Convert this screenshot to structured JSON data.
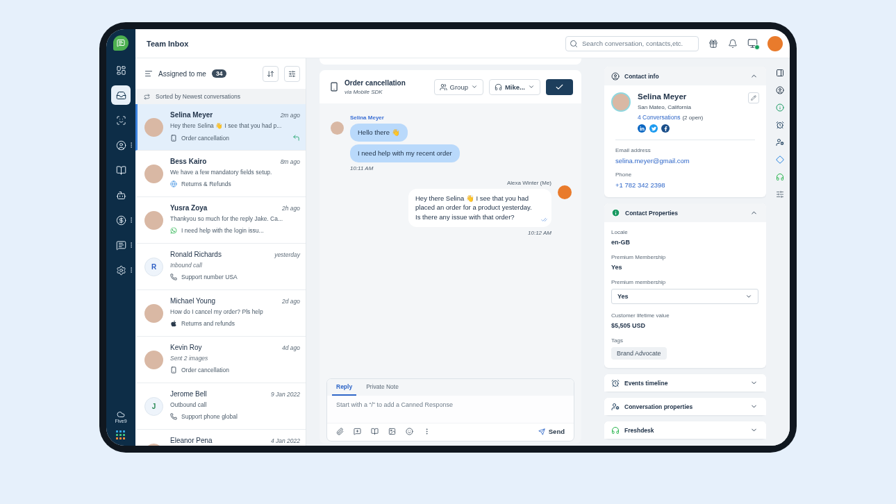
{
  "nav": {
    "items": [
      {
        "kind": "dashboard",
        "selected": false,
        "more": false
      },
      {
        "kind": "inbox",
        "selected": true,
        "more": false
      },
      {
        "kind": "contact-scan",
        "selected": false,
        "more": false
      },
      {
        "kind": "contact",
        "selected": false,
        "more": true
      },
      {
        "kind": "book",
        "selected": false,
        "more": false
      },
      {
        "kind": "bot",
        "selected": false,
        "more": false
      },
      {
        "kind": "dollar",
        "selected": false,
        "more": true
      },
      {
        "kind": "chat",
        "selected": false,
        "more": true
      },
      {
        "kind": "settings",
        "selected": false,
        "more": true
      }
    ],
    "logo_text": "Five9"
  },
  "header": {
    "title": "Team Inbox",
    "search": {
      "placeholder": "Search conversation, contacts,etc."
    }
  },
  "list": {
    "filter": "Assigned to me",
    "count": "34",
    "sort_info": "Sorted by Newest conversations",
    "conversations": [
      {
        "name": "Selina Meyer",
        "preview": "Hey there Selina 👋 I see that you had p...",
        "preview_italic": false,
        "time": "2m ago",
        "channel": {
          "kind": "mobile",
          "label": "Order cancellation"
        },
        "avatar": {
          "kind": "photo"
        },
        "selected": true,
        "unread": true,
        "replied": true
      },
      {
        "name": "Bess Kairo",
        "preview": "We have a few mandatory fields setup.",
        "preview_italic": false,
        "time": "8m ago",
        "channel": {
          "kind": "web",
          "label": "Returns & Refunds"
        },
        "avatar": {
          "kind": "photo"
        },
        "selected": false,
        "unread": true,
        "replied": false
      },
      {
        "name": "Yusra Zoya",
        "preview": "Thankyou so much for the reply Jake. Ca...",
        "preview_italic": false,
        "time": "2h ago",
        "channel": {
          "kind": "whatsapp",
          "label": "I need help with the login issu..."
        },
        "avatar": {
          "kind": "photo"
        },
        "selected": false,
        "unread": true,
        "replied": false
      },
      {
        "name": "Ronald Richards",
        "preview": "Inbound call",
        "preview_italic": true,
        "time": "yesterday",
        "channel": {
          "kind": "phone",
          "label": "Support number USA"
        },
        "avatar": {
          "kind": "initial",
          "initial": "R",
          "color": "#2f5fc4"
        },
        "selected": false,
        "unread": false,
        "replied": false
      },
      {
        "name": "Michael Young",
        "preview": "How do I cancel my order? Pls help",
        "preview_italic": false,
        "time": "2d ago",
        "channel": {
          "kind": "apple",
          "label": "Returns and refunds"
        },
        "avatar": {
          "kind": "photo"
        },
        "selected": false,
        "unread": false,
        "replied": false
      },
      {
        "name": "Kevin Roy",
        "preview": "Sent 2 images",
        "preview_italic": true,
        "time": "4d ago",
        "channel": {
          "kind": "mobile",
          "label": "Order cancellation"
        },
        "avatar": {
          "kind": "photo"
        },
        "selected": false,
        "unread": false,
        "replied": false
      },
      {
        "name": "Jerome Bell",
        "preview": "Outbound call",
        "preview_italic": false,
        "time": "9 Jan 2022",
        "channel": {
          "kind": "phone",
          "label": "Support phone global"
        },
        "avatar": {
          "kind": "initial",
          "initial": "J",
          "color": "#2a8a55"
        },
        "selected": false,
        "unread": false,
        "replied": false
      },
      {
        "name": "Eleanor Pena",
        "time": "4 Jan 2022",
        "avatar": {
          "kind": "photo"
        },
        "selected": false,
        "unread": false
      }
    ]
  },
  "conversation": {
    "title": "Order cancellation",
    "subtitle": "via Mobile SDK",
    "group_label": "Group",
    "agent_label": "Mike...",
    "messages": [
      {
        "kind": "incoming",
        "sender": "Selina Meyer",
        "bubbles": [
          "Hello there 👋",
          "I need help with my recent order"
        ],
        "time": "10:11 AM"
      },
      {
        "kind": "outgoing",
        "sender": "Alexa Winter (Me)",
        "bubbles": [
          "Hey there Selina 👋 I see that you had placed an order for a product yesterday. Is there any issue with that order?"
        ],
        "time": "10:12 AM",
        "read": true
      }
    ],
    "composer": {
      "tabs": [
        {
          "label": "Reply",
          "selected": true
        },
        {
          "label": "Private Note",
          "selected": false
        }
      ],
      "placeholder": "Start with a “/” to add a Canned Response",
      "send_label": "Send"
    }
  },
  "contact": {
    "title": "Contact info",
    "expanded": true,
    "name": "Selina Meyer",
    "location": "San Mateo, California",
    "conversations_link": "4 Conversations",
    "conversations_note": "(2 open)",
    "socials": [
      {
        "kind": "linkedin"
      },
      {
        "kind": "twitter"
      },
      {
        "kind": "facebook"
      }
    ],
    "fields": [
      {
        "label": "Email address",
        "value": "selina.meyer@gmail.com"
      },
      {
        "label": "Phone",
        "value": "+1 782 342 2398"
      }
    ]
  },
  "properties": {
    "title": "Contact Properties",
    "expanded": true,
    "items": [
      {
        "kind": "text",
        "label": "Locale",
        "value": "en-GB"
      },
      {
        "kind": "text",
        "label": "Premium Membership",
        "value": "Yes"
      },
      {
        "kind": "select",
        "label": "Premium membership",
        "value": "Yes"
      },
      {
        "kind": "text",
        "label": "Customer lifetime value",
        "value": "$5,505 USD"
      },
      {
        "kind": "tags",
        "label": "Tags",
        "tags": [
          "Brand Advocate"
        ]
      }
    ]
  },
  "sections": [
    {
      "kind": "events",
      "title": "Events timeline",
      "expanded": false
    },
    {
      "kind": "conversation",
      "title": "Conversation properties",
      "expanded": false
    },
    {
      "kind": "freshdesk",
      "title": "Freshdesk",
      "expanded": false
    }
  ],
  "rail": [
    {
      "kind": "panel"
    },
    {
      "kind": "contact"
    },
    {
      "kind": "info"
    },
    {
      "kind": "events"
    },
    {
      "kind": "conversation"
    },
    {
      "kind": "diamond"
    },
    {
      "kind": "freshdesk"
    },
    {
      "kind": "sliders"
    }
  ]
}
